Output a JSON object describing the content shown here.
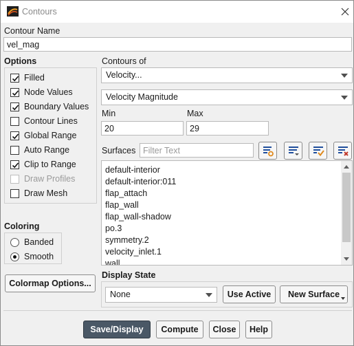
{
  "window": {
    "title": "Contours",
    "app_icon": "fluent-contour-icon",
    "close_icon": "close-icon"
  },
  "contour_name": {
    "label": "Contour Name",
    "value": "vel_mag"
  },
  "options": {
    "label": "Options",
    "items": [
      {
        "label": "Filled",
        "checked": true,
        "enabled": true
      },
      {
        "label": "Node Values",
        "checked": true,
        "enabled": true
      },
      {
        "label": "Boundary Values",
        "checked": true,
        "enabled": true
      },
      {
        "label": "Contour Lines",
        "checked": false,
        "enabled": true
      },
      {
        "label": "Global Range",
        "checked": true,
        "enabled": true
      },
      {
        "label": "Auto Range",
        "checked": false,
        "enabled": true
      },
      {
        "label": "Clip to Range",
        "checked": true,
        "enabled": true
      },
      {
        "label": "Draw Profiles",
        "checked": false,
        "enabled": false
      },
      {
        "label": "Draw Mesh",
        "checked": false,
        "enabled": true
      }
    ]
  },
  "contours_of": {
    "label": "Contours of",
    "category": "Velocity...",
    "quantity": "Velocity Magnitude"
  },
  "range": {
    "min_label": "Min",
    "min_value": "20",
    "max_label": "Max",
    "max_value": "29"
  },
  "surfaces": {
    "label": "Surfaces",
    "filter_placeholder": "Filter Text",
    "tool_icons": [
      "select-all-surfaces-icon",
      "surface-list-dropdown-icon",
      "select-surfaces-check-icon",
      "deselect-surfaces-icon"
    ],
    "items": [
      "default-interior",
      "default-interior:011",
      "flap_attach",
      "flap_wall",
      "flap_wall-shadow",
      "po.3",
      "symmetry.2",
      "velocity_inlet.1",
      "wall"
    ]
  },
  "coloring": {
    "label": "Coloring",
    "options": [
      {
        "label": "Banded",
        "selected": false
      },
      {
        "label": "Smooth",
        "selected": true
      }
    ]
  },
  "colormap_button": "Colormap Options...",
  "display_state": {
    "label": "Display State",
    "value": "None",
    "use_active": "Use Active",
    "new_surface": "New Surface"
  },
  "footer": {
    "save_display": "Save/Display",
    "compute": "Compute",
    "close": "Close",
    "help": "Help"
  },
  "colors": {
    "primary_button": "#4a5866",
    "icon_blue": "#1f4e9c",
    "icon_orange": "#e08a1e",
    "icon_green": "#3b8a2e",
    "icon_red": "#c0392b"
  }
}
